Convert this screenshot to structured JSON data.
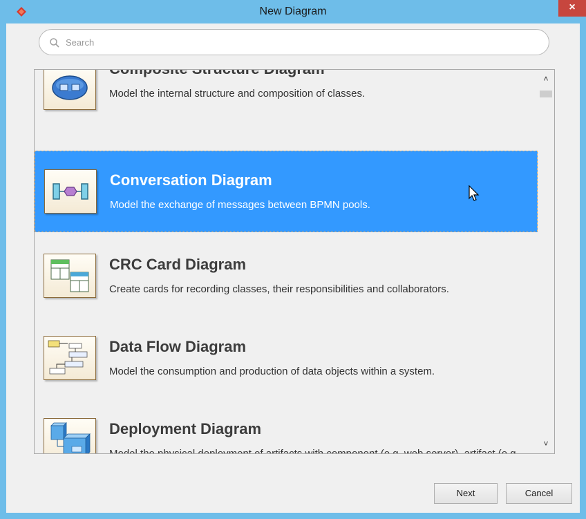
{
  "window": {
    "title": "New Diagram",
    "close_label": "×"
  },
  "search": {
    "placeholder": "Search",
    "value": ""
  },
  "items": [
    {
      "title": "Composite Structure Diagram",
      "description": "Model the internal structure and composition of classes.",
      "icon": "composite-structure-icon"
    },
    {
      "title": "Conversation Diagram",
      "description": "Model the exchange of messages between BPMN pools.",
      "icon": "conversation-icon",
      "selected": true
    },
    {
      "title": "CRC Card Diagram",
      "description": "Create cards for recording classes, their responsibilities and collaborators.",
      "icon": "crc-card-icon"
    },
    {
      "title": "Data Flow Diagram",
      "description": "Model the consumption and production of data objects within a system.",
      "icon": "data-flow-icon"
    },
    {
      "title": "Deployment Diagram",
      "description": "Model the physical deployment of artifacts with component (e.g. web server), artifact (e.g. jar file) and node (web application, DB).",
      "icon": "deployment-icon"
    }
  ],
  "buttons": {
    "next_label": "Next",
    "cancel_label": "Cancel"
  },
  "colors": {
    "titlebar": "#6ebde9",
    "selection": "#3399ff",
    "close": "#c7463e"
  }
}
